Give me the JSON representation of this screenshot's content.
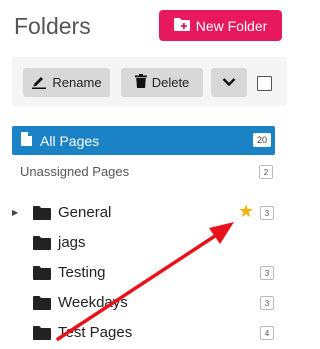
{
  "header": {
    "title": "Folders",
    "new_folder_label": "New Folder"
  },
  "toolbar": {
    "rename_label": "Rename",
    "delete_label": "Delete"
  },
  "all_pages": {
    "label": "All Pages",
    "count": "20"
  },
  "unassigned": {
    "label": "Unassigned Pages",
    "count": "2"
  },
  "folders": [
    {
      "label": "General",
      "count": "3",
      "starred": true,
      "expandable": true
    },
    {
      "label": "jags",
      "count": "",
      "starred": false,
      "expandable": false
    },
    {
      "label": "Testing",
      "count": "3",
      "starred": false,
      "expandable": false
    },
    {
      "label": "Weekdays",
      "count": "3",
      "starred": false,
      "expandable": false
    },
    {
      "label": "Test Pages",
      "count": "4",
      "starred": false,
      "expandable": false
    }
  ],
  "colors": {
    "accent_pink": "#e8185f",
    "accent_blue": "#1b82c6",
    "star": "#f0b30f",
    "annotation_arrow": "#e8121a"
  },
  "icons": {
    "new_folder": "folder-plus-icon",
    "rename": "pen-icon",
    "delete": "trash-icon",
    "dropdown": "chevron-down-icon",
    "all_pages": "page-icon",
    "folder": "folder-icon",
    "expand": "caret-right-icon",
    "favorite": "star-icon"
  }
}
